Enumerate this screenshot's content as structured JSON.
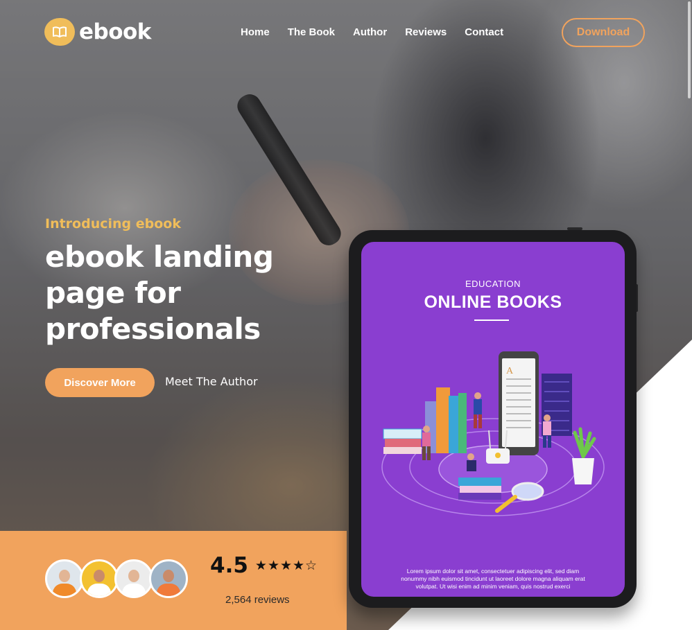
{
  "header": {
    "logo_text": "ebook",
    "nav": [
      {
        "label": "Home"
      },
      {
        "label": "The Book"
      },
      {
        "label": "Author"
      },
      {
        "label": "Reviews"
      },
      {
        "label": "Contact"
      }
    ],
    "download_label": "Download"
  },
  "hero": {
    "eyebrow": "Introducing ebook",
    "headline": "ebook landing page for professionals",
    "primary_button": "Discover More",
    "secondary_link": "Meet The Author"
  },
  "reviews": {
    "rating": "4.5",
    "rating_value": 4.5,
    "stars_display": "★★★★☆",
    "count": "2,564 reviews",
    "avatars": [
      {
        "bg": "#dfe6ec",
        "shirt": "#f08a2a"
      },
      {
        "bg": "#f3c130",
        "shirt": "#ffffff"
      },
      {
        "bg": "#ececec",
        "shirt": "#ffffff"
      },
      {
        "bg": "#9fb3c6",
        "shirt": "#f07a3a"
      }
    ]
  },
  "tablet": {
    "kicker": "EDUCATION",
    "title": "ONLINE BOOKS",
    "body": "Lorem ipsum dolor sit amet, consectetuer adipiscing elit, sed diam nonummy nibh euismod tincidunt ut laoreet dolore magna aliquam erat volutpat. Ut wisi enim ad minim veniam, quis nostrud exerci"
  },
  "colors": {
    "accent": "#f1a35d",
    "logo_yellow": "#f0bd5a",
    "screen_purple": "#8a3ed0"
  },
  "icons": {
    "logo": "open-book-icon",
    "star": "star-icon"
  }
}
